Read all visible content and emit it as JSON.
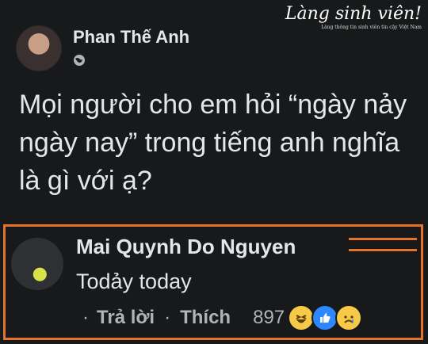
{
  "post": {
    "author": "Phan Thế Anh",
    "text": "Mọi người cho em hỏi “ngày nảy ngày nay” trong tiếng anh nghĩa là gì với ạ?"
  },
  "watermark": {
    "title": "Làng sinh viên!",
    "subtitle": "Làng thông tin sinh viên tin cậy Việt Nam"
  },
  "comment": {
    "author": "Mai Quynh Do Nguyen",
    "text": "Todảy today",
    "actions": {
      "reply": "Trả lời",
      "like": "Thích",
      "reaction_count": "897"
    },
    "reactions": [
      "haha-icon",
      "like-icon",
      "sad-icon"
    ]
  },
  "colors": {
    "background": "#18191a",
    "highlight": "#e4742a",
    "text": "#e4e6eb",
    "muted": "#b0b3b8"
  }
}
